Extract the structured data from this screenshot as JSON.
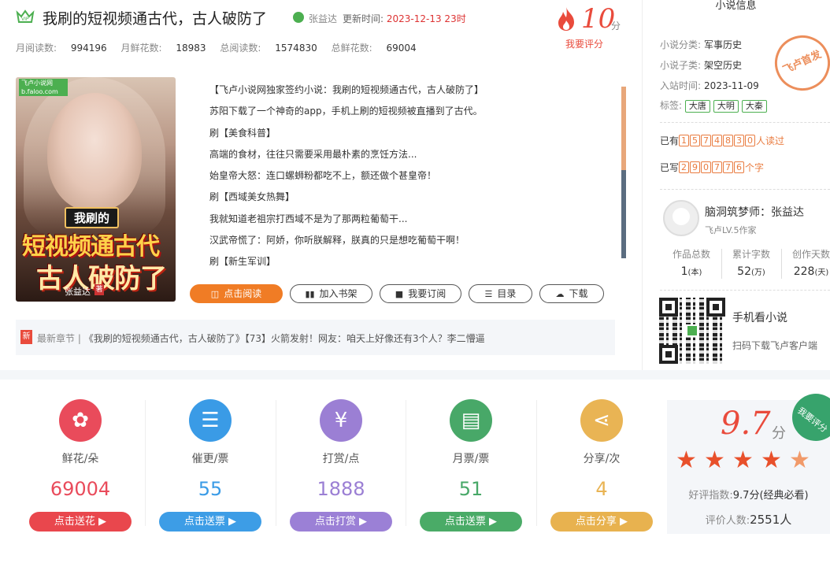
{
  "header": {
    "title": "我刷的短视频通古代，古人破防了",
    "author": "张益达",
    "update_label": "更新时间:",
    "update_time": "2023-12-13 23时",
    "stats": [
      {
        "label": "月阅读数:",
        "value": "994196"
      },
      {
        "label": "月鲜花数:",
        "value": "18983"
      },
      {
        "label": "总阅读数:",
        "value": "1574830"
      },
      {
        "label": "总鲜花数:",
        "value": "69004"
      }
    ],
    "score": "10",
    "score_unit": "分",
    "rate_link": "我要评分"
  },
  "cover": {
    "logo": "飞卢小说网 b.faloo.com",
    "title_line1": "我刷的",
    "title_line2": "短视频通古代",
    "title_line3": "古人破防了",
    "author": "张益达",
    "author_tag": "著"
  },
  "intro": [
    "【飞卢小说网独家签约小说：我刷的短视频通古代，古人破防了】",
    "苏阳下载了一个神奇的app，手机上刷的短视频被直播到了古代。",
    "刷【美食科普】",
    "高端的食材，往往只需要采用最朴素的烹饪方法...",
    "始皇帝大怒：连口螺蛳粉都吃不上，额还做个甚皇帝！",
    "刷【西域美女热舞】",
    "我就知道老祖宗打西域不是为了那两粒葡萄干...",
    "汉武帝慌了：阿娇，你听朕解释，朕真的只是想吃葡萄干啊！",
    "刷【新生军训】"
  ],
  "buttons": {
    "read": "点击阅读",
    "shelf": "加入书架",
    "subscribe": "我要订阅",
    "catalog": "目录",
    "download": "下载"
  },
  "latest": {
    "tag": "新",
    "label": "最新章节 |",
    "text": "《我刷的短视频通古代，古人破防了》【73】火箭发射！网友：咱天上好像还有3个人？李二懵逼"
  },
  "info": {
    "title": "小说信息",
    "category_label": "小说分类:",
    "category": "军事历史",
    "subcategory_label": "小说子类:",
    "subcategory": "架空历史",
    "date_label": "入站时间:",
    "date": "2023-11-09",
    "tags_label": "标签:",
    "tags": [
      "大唐",
      "大明",
      "大秦"
    ],
    "stamp": "飞卢首发",
    "readers_prefix": "已有",
    "readers_digits": [
      "1",
      "5",
      "7",
      "4",
      "8",
      "3",
      "0"
    ],
    "readers_suffix": "人读过",
    "words_prefix": "已写",
    "words_digits": [
      "2",
      "9",
      "0",
      "7",
      "7",
      "6"
    ],
    "words_suffix": "个字"
  },
  "author_card": {
    "name": "脑洞筑梦师：张益达",
    "level": "飞卢LV.5作家",
    "stats": [
      {
        "label": "作品总数",
        "value": "1",
        "unit": "(本)"
      },
      {
        "label": "累计字数",
        "value": "52",
        "unit": "(万)"
      },
      {
        "label": "创作天数",
        "value": "228",
        "unit": "(天)"
      }
    ]
  },
  "qr": {
    "title": "手机看小说",
    "sub": "扫码下载飞卢客户端"
  },
  "bottom": [
    {
      "label": "鲜花/朵",
      "value": "69004",
      "button": "点击送花 ▶",
      "color": "#e94b5b",
      "btn_color": "#e9474d",
      "icon": "flower-icon",
      "glyph": "✿"
    },
    {
      "label": "催更/票",
      "value": "55",
      "button": "点击送票 ▶",
      "color": "#3a9be6",
      "btn_color": "#3d9de6",
      "icon": "ticket-icon",
      "glyph": "☰"
    },
    {
      "label": "打赏/点",
      "value": "1888",
      "button": "点击打赏 ▶",
      "color": "#9b7fd4",
      "btn_color": "#9b80d6",
      "icon": "yen-icon",
      "glyph": "¥"
    },
    {
      "label": "月票/票",
      "value": "51",
      "button": "点击送票 ▶",
      "color": "#48a868",
      "btn_color": "#4aab67",
      "icon": "wallet-icon",
      "glyph": "▤"
    },
    {
      "label": "分享/次",
      "value": "4",
      "button": "点击分享 ▶",
      "color": "#e9b454",
      "btn_color": "#e8b24f",
      "icon": "share-icon",
      "glyph": "⋖"
    }
  ],
  "rating": {
    "score": "9.7",
    "unit": "分",
    "corner": "我要评分",
    "stars": 4.7,
    "good_label": "好评指数:",
    "good_value": "9.7分(经典必看)",
    "count_label": "评价人数:",
    "count_value": "2551人"
  }
}
